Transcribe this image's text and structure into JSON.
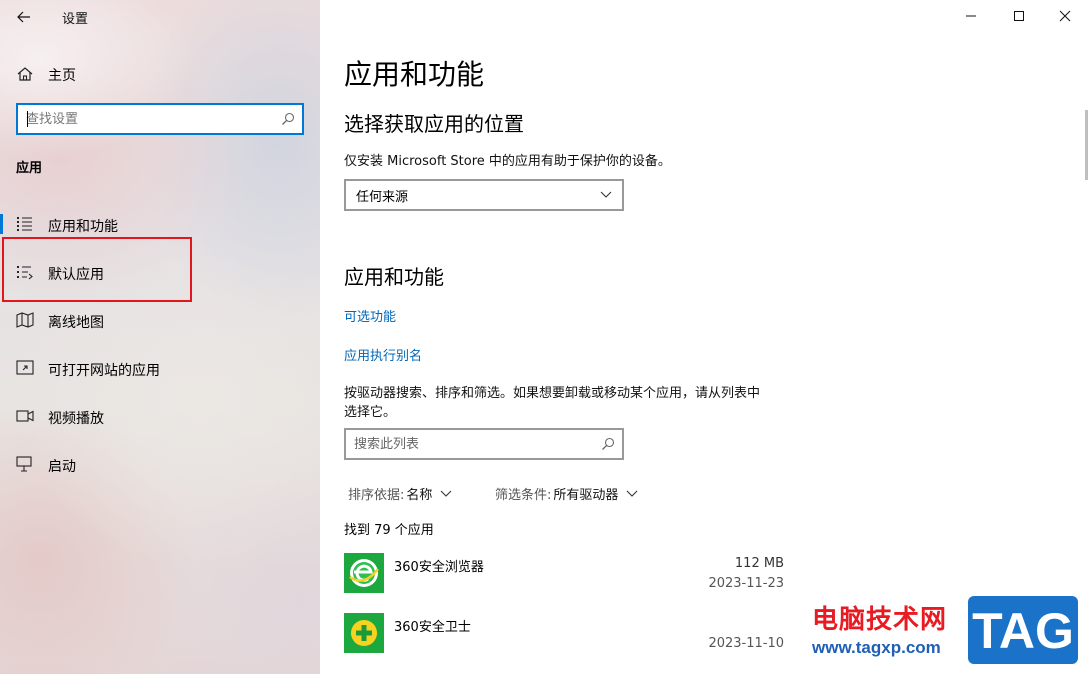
{
  "window": {
    "title": "设置",
    "controls": [
      "minimize",
      "maximize",
      "close"
    ]
  },
  "sidebar": {
    "home_label": "主页",
    "search_placeholder": "查找设置",
    "section_title": "应用",
    "items": [
      {
        "label": "应用和功能",
        "icon": "apps-features-icon",
        "active": true
      },
      {
        "label": "默认应用",
        "icon": "default-apps-icon",
        "active": false,
        "highlighted": true
      },
      {
        "label": "离线地图",
        "icon": "offline-maps-icon",
        "active": false
      },
      {
        "label": "可打开网站的应用",
        "icon": "apps-for-websites-icon",
        "active": false
      },
      {
        "label": "视频播放",
        "icon": "video-playback-icon",
        "active": false
      },
      {
        "label": "启动",
        "icon": "startup-icon",
        "active": false
      }
    ]
  },
  "main": {
    "page_title": "应用和功能",
    "install_section": {
      "heading": "选择获取应用的位置",
      "description": "仅安装 Microsoft Store 中的应用有助于保护你的设备。",
      "dropdown_value": "任何来源"
    },
    "apps_section": {
      "heading": "应用和功能",
      "links": [
        "可选功能",
        "应用执行别名"
      ],
      "description_line1": "按驱动器搜索、排序和筛选。如果想要卸载或移动某个应用，请从列表中",
      "description_line2": "选择它。",
      "search_placeholder": "搜索此列表",
      "sort_label": "排序依据:",
      "sort_value": "名称",
      "filter_label": "筛选条件:",
      "filter_value": "所有驱动器",
      "count_text": "找到 79 个应用",
      "apps": [
        {
          "name": "360安全浏览器",
          "size": "112 MB",
          "date": "2023-11-23",
          "icon": "browser-360-icon"
        },
        {
          "name": "360安全卫士",
          "size": "",
          "date": "2023-11-10",
          "icon": "security-guard-360-icon"
        }
      ]
    }
  },
  "watermark": {
    "chinese": "电脑技术网",
    "url": "www.tagxp.com",
    "logo": "TAG"
  },
  "colors": {
    "accent": "#0078d7",
    "link": "#0067b8",
    "highlight_box": "#e2161d",
    "watermark_red": "#e81b23",
    "watermark_blue": "#1f5fb5",
    "tag_logo_bg": "#1a73c9"
  }
}
